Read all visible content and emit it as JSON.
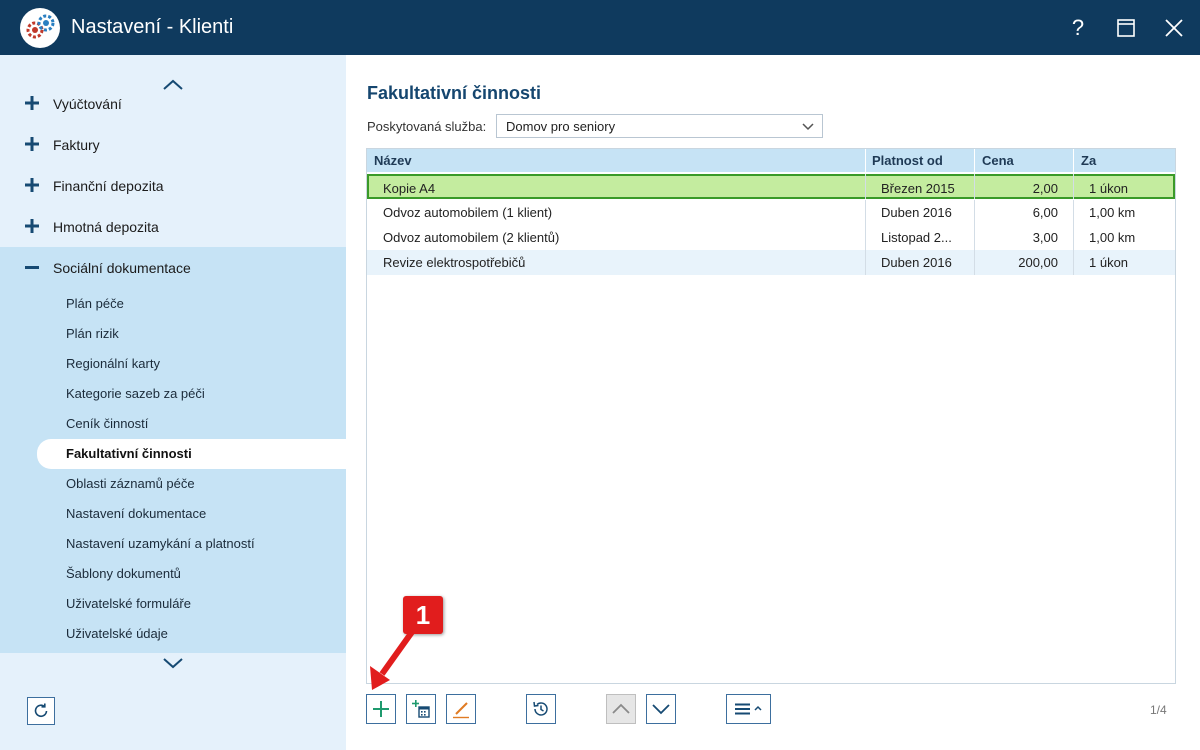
{
  "window": {
    "title": "Nastavení - Klienti",
    "help_label": "?"
  },
  "sidebar": {
    "top_items": [
      {
        "label": "Vyúčtování"
      },
      {
        "label": "Faktury"
      },
      {
        "label": "Finanční depozita"
      },
      {
        "label": "Hmotná depozita"
      }
    ],
    "section": {
      "label": "Sociální dokumentace",
      "items": [
        {
          "label": "Plán péče"
        },
        {
          "label": "Plán rizik"
        },
        {
          "label": "Regionální karty"
        },
        {
          "label": "Kategorie sazeb za péči"
        },
        {
          "label": "Ceník činností"
        },
        {
          "label": "Fakultativní činnosti"
        },
        {
          "label": "Oblasti záznamů péče"
        },
        {
          "label": "Nastavení dokumentace"
        },
        {
          "label": "Nastavení uzamykání a platností"
        },
        {
          "label": "Šablony dokumentů"
        },
        {
          "label": "Uživatelské formuláře"
        },
        {
          "label": "Uživatelské údaje"
        }
      ]
    }
  },
  "main": {
    "title": "Fakultativní činnosti",
    "service_label": "Poskytovaná služba:",
    "service_value": "Domov pro seniory",
    "table": {
      "columns": [
        "Název",
        "Platnost od",
        "Cena",
        "Za"
      ],
      "rows": [
        {
          "name": "Kopie A4",
          "valid_from": "Březen 2015",
          "price": "2,00",
          "per": "1 úkon"
        },
        {
          "name": "Odvoz automobilem (1 klient)",
          "valid_from": "Duben 2016",
          "price": "6,00",
          "per": "1,00 km"
        },
        {
          "name": "Odvoz automobilem (2 klientů)",
          "valid_from": "Listopad 2...",
          "price": "3,00",
          "per": "1,00 km"
        },
        {
          "name": "Revize elektrospotřebičů",
          "valid_from": "Duben 2016",
          "price": "200,00",
          "per": "1 úkon"
        }
      ]
    },
    "pager": "1/4",
    "callout_number": "1"
  },
  "colors": {
    "titlebar": "#0f3a5e",
    "sidebar": "#e5f1fb",
    "sidebar_section": "#c6e3f5",
    "accent": "#15466f",
    "selected_row": "#c4ec9f",
    "callout": "#e11d1d"
  },
  "icons": {
    "logo": "gears-icon",
    "help": "help-icon",
    "maximize": "maximize-icon",
    "close": "close-icon",
    "add": "plus-icon",
    "add_dated": "calendar-plus-icon",
    "edit": "pencil-icon",
    "history": "history-icon",
    "move_up": "chevron-up-icon",
    "move_down": "chevron-down-icon",
    "menu": "menu-icon",
    "refresh": "refresh-icon"
  }
}
